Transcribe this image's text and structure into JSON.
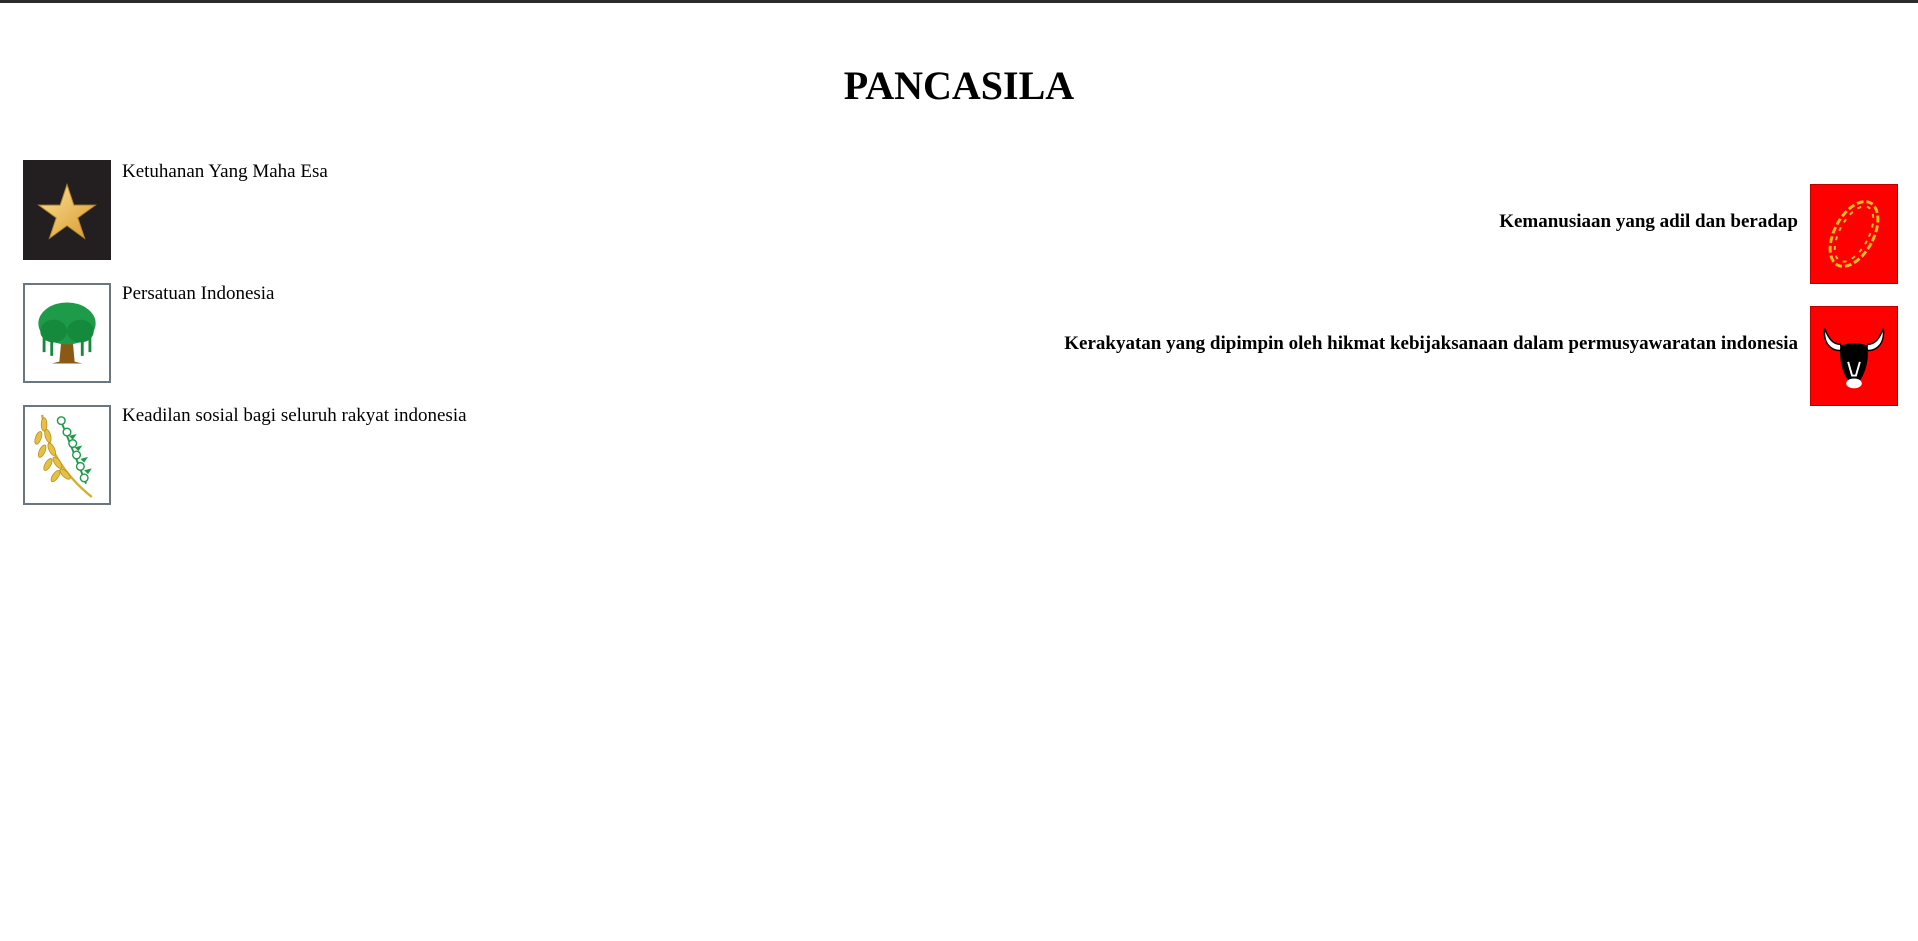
{
  "title": "PANCASILA",
  "sila": [
    {
      "label": "Ketuhanan Yang Maha Esa",
      "icon": "star-icon"
    },
    {
      "label": "Kemanusiaan yang adil dan beradap",
      "icon": "chain-icon"
    },
    {
      "label": "Persatuan Indonesia",
      "icon": "banyan-tree-icon"
    },
    {
      "label": "Kerakyatan yang dipimpin oleh hikmat kebijaksanaan dalam permusyawaratan indonesia",
      "icon": "bull-head-icon"
    },
    {
      "label": "Keadilan sosial bagi seluruh rakyat indonesia",
      "icon": "rice-cotton-icon"
    }
  ],
  "colors": {
    "star_bg": "#231f20",
    "star": "#f3c25d",
    "red_bg": "#ff0000",
    "chain": "#f2c01e",
    "tree": "#1e9b48",
    "trunk": "#8a5a14",
    "rice": "#e6c043",
    "box_border": "#6b7780"
  }
}
